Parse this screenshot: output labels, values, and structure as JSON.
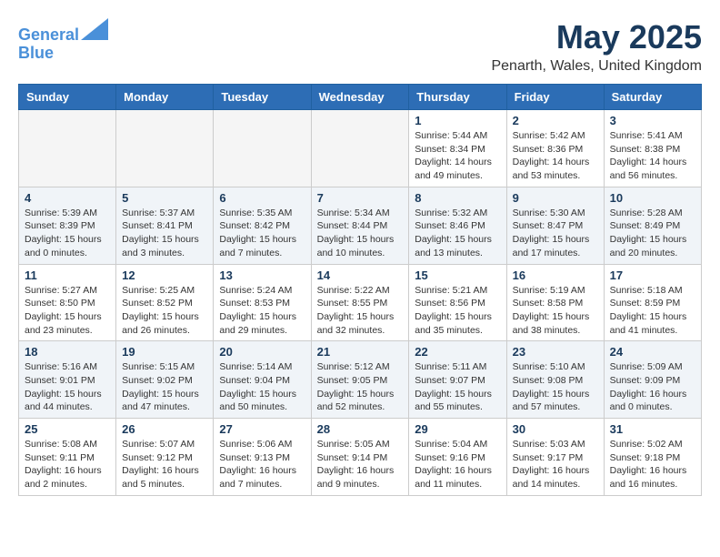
{
  "header": {
    "logo_line1": "General",
    "logo_line2": "Blue",
    "title": "May 2025",
    "subtitle": "Penarth, Wales, United Kingdom"
  },
  "days_of_week": [
    "Sunday",
    "Monday",
    "Tuesday",
    "Wednesday",
    "Thursday",
    "Friday",
    "Saturday"
  ],
  "weeks": [
    [
      {
        "day": "",
        "info": ""
      },
      {
        "day": "",
        "info": ""
      },
      {
        "day": "",
        "info": ""
      },
      {
        "day": "",
        "info": ""
      },
      {
        "day": "1",
        "info": "Sunrise: 5:44 AM\nSunset: 8:34 PM\nDaylight: 14 hours\nand 49 minutes."
      },
      {
        "day": "2",
        "info": "Sunrise: 5:42 AM\nSunset: 8:36 PM\nDaylight: 14 hours\nand 53 minutes."
      },
      {
        "day": "3",
        "info": "Sunrise: 5:41 AM\nSunset: 8:38 PM\nDaylight: 14 hours\nand 56 minutes."
      }
    ],
    [
      {
        "day": "4",
        "info": "Sunrise: 5:39 AM\nSunset: 8:39 PM\nDaylight: 15 hours\nand 0 minutes."
      },
      {
        "day": "5",
        "info": "Sunrise: 5:37 AM\nSunset: 8:41 PM\nDaylight: 15 hours\nand 3 minutes."
      },
      {
        "day": "6",
        "info": "Sunrise: 5:35 AM\nSunset: 8:42 PM\nDaylight: 15 hours\nand 7 minutes."
      },
      {
        "day": "7",
        "info": "Sunrise: 5:34 AM\nSunset: 8:44 PM\nDaylight: 15 hours\nand 10 minutes."
      },
      {
        "day": "8",
        "info": "Sunrise: 5:32 AM\nSunset: 8:46 PM\nDaylight: 15 hours\nand 13 minutes."
      },
      {
        "day": "9",
        "info": "Sunrise: 5:30 AM\nSunset: 8:47 PM\nDaylight: 15 hours\nand 17 minutes."
      },
      {
        "day": "10",
        "info": "Sunrise: 5:28 AM\nSunset: 8:49 PM\nDaylight: 15 hours\nand 20 minutes."
      }
    ],
    [
      {
        "day": "11",
        "info": "Sunrise: 5:27 AM\nSunset: 8:50 PM\nDaylight: 15 hours\nand 23 minutes."
      },
      {
        "day": "12",
        "info": "Sunrise: 5:25 AM\nSunset: 8:52 PM\nDaylight: 15 hours\nand 26 minutes."
      },
      {
        "day": "13",
        "info": "Sunrise: 5:24 AM\nSunset: 8:53 PM\nDaylight: 15 hours\nand 29 minutes."
      },
      {
        "day": "14",
        "info": "Sunrise: 5:22 AM\nSunset: 8:55 PM\nDaylight: 15 hours\nand 32 minutes."
      },
      {
        "day": "15",
        "info": "Sunrise: 5:21 AM\nSunset: 8:56 PM\nDaylight: 15 hours\nand 35 minutes."
      },
      {
        "day": "16",
        "info": "Sunrise: 5:19 AM\nSunset: 8:58 PM\nDaylight: 15 hours\nand 38 minutes."
      },
      {
        "day": "17",
        "info": "Sunrise: 5:18 AM\nSunset: 8:59 PM\nDaylight: 15 hours\nand 41 minutes."
      }
    ],
    [
      {
        "day": "18",
        "info": "Sunrise: 5:16 AM\nSunset: 9:01 PM\nDaylight: 15 hours\nand 44 minutes."
      },
      {
        "day": "19",
        "info": "Sunrise: 5:15 AM\nSunset: 9:02 PM\nDaylight: 15 hours\nand 47 minutes."
      },
      {
        "day": "20",
        "info": "Sunrise: 5:14 AM\nSunset: 9:04 PM\nDaylight: 15 hours\nand 50 minutes."
      },
      {
        "day": "21",
        "info": "Sunrise: 5:12 AM\nSunset: 9:05 PM\nDaylight: 15 hours\nand 52 minutes."
      },
      {
        "day": "22",
        "info": "Sunrise: 5:11 AM\nSunset: 9:07 PM\nDaylight: 15 hours\nand 55 minutes."
      },
      {
        "day": "23",
        "info": "Sunrise: 5:10 AM\nSunset: 9:08 PM\nDaylight: 15 hours\nand 57 minutes."
      },
      {
        "day": "24",
        "info": "Sunrise: 5:09 AM\nSunset: 9:09 PM\nDaylight: 16 hours\nand 0 minutes."
      }
    ],
    [
      {
        "day": "25",
        "info": "Sunrise: 5:08 AM\nSunset: 9:11 PM\nDaylight: 16 hours\nand 2 minutes."
      },
      {
        "day": "26",
        "info": "Sunrise: 5:07 AM\nSunset: 9:12 PM\nDaylight: 16 hours\nand 5 minutes."
      },
      {
        "day": "27",
        "info": "Sunrise: 5:06 AM\nSunset: 9:13 PM\nDaylight: 16 hours\nand 7 minutes."
      },
      {
        "day": "28",
        "info": "Sunrise: 5:05 AM\nSunset: 9:14 PM\nDaylight: 16 hours\nand 9 minutes."
      },
      {
        "day": "29",
        "info": "Sunrise: 5:04 AM\nSunset: 9:16 PM\nDaylight: 16 hours\nand 11 minutes."
      },
      {
        "day": "30",
        "info": "Sunrise: 5:03 AM\nSunset: 9:17 PM\nDaylight: 16 hours\nand 14 minutes."
      },
      {
        "day": "31",
        "info": "Sunrise: 5:02 AM\nSunset: 9:18 PM\nDaylight: 16 hours\nand 16 minutes."
      }
    ]
  ]
}
